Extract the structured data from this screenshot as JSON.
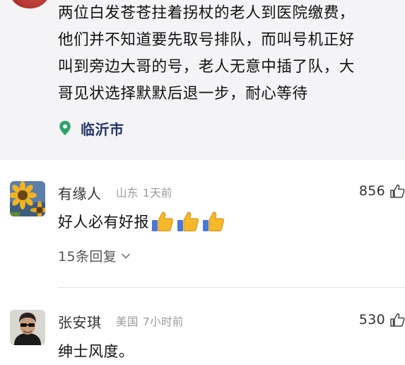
{
  "post": {
    "lines": [
      "两位白发苍苍拄着拐杖的老人到医院缴费，",
      "他们并不知道要先取号排队，而叫号机正好",
      "叫到旁边大哥的号，老人无意中插了队，大",
      "哥见状选择默默后退一步，耐心等待"
    ],
    "location": "临沂市",
    "location_icon": "location-pin-icon"
  },
  "comments": [
    {
      "name": "有缘人",
      "region": "山东",
      "time": "1天前",
      "likes": "856",
      "text": "好人必有好报",
      "emoji": [
        "thumbs-up-icon",
        "thumbs-up-icon",
        "thumbs-up-icon"
      ],
      "replies_label": "15条回复"
    },
    {
      "name": "张安琪",
      "region": "美国",
      "time": "7小时前",
      "likes": "530",
      "text": "绅士风度。"
    }
  ],
  "colors": {
    "post_bg": "#f4f4f6",
    "location_blue": "#23336a",
    "location_green": "#2ca36b",
    "meta_gray": "#9a9a9a"
  }
}
